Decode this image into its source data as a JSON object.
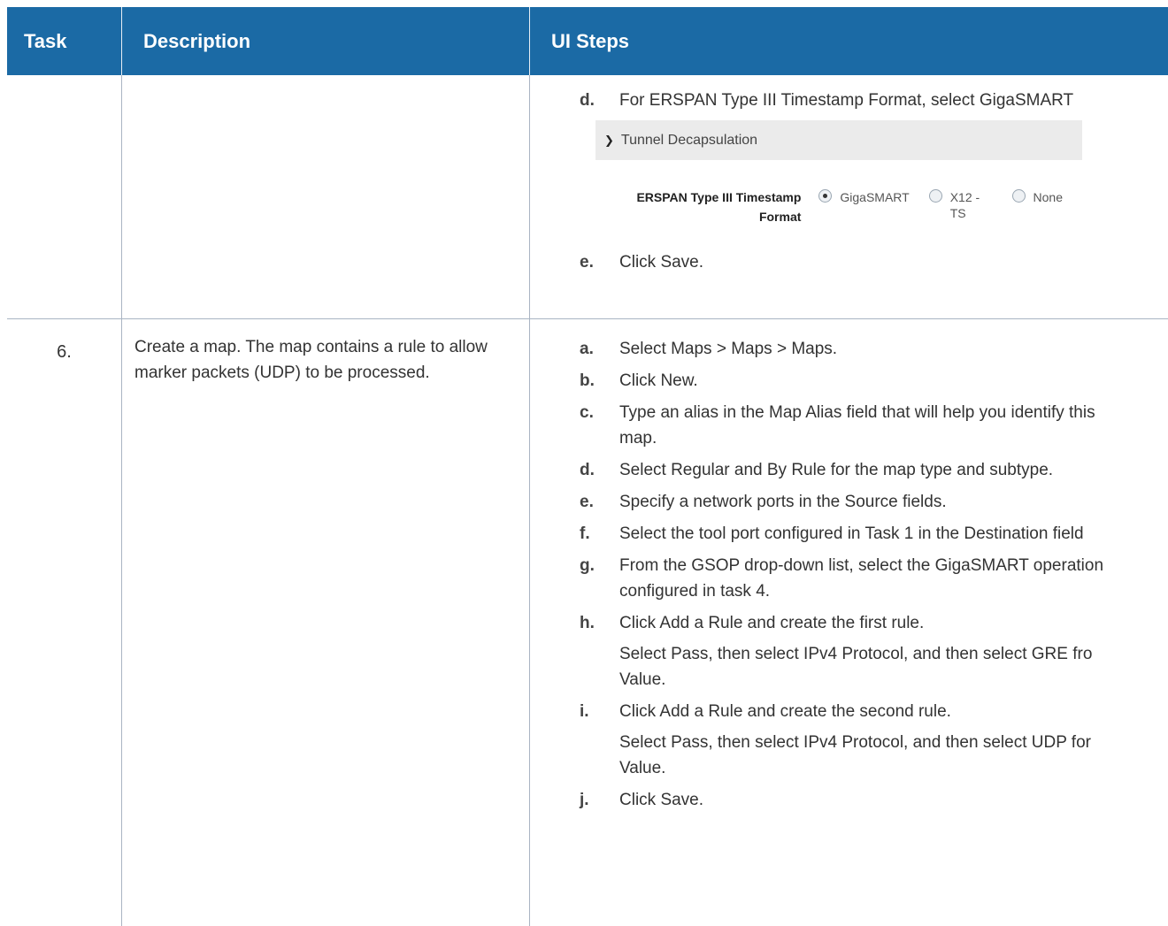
{
  "header": {
    "task": "Task",
    "description": "Description",
    "ui_steps": "UI Steps"
  },
  "row1": {
    "task": "",
    "description": "",
    "steps": [
      {
        "letter": "d.",
        "text": "For ERSPAN Type III Timestamp Format, select GigaSMART"
      },
      {
        "letter": "e.",
        "text": "Click Save."
      }
    ],
    "screenshot": {
      "section_title": "Tunnel Decapsulation",
      "field_label": "ERSPAN Type III Timestamp Format",
      "options": [
        "GigaSMART",
        "X12 - TS",
        "None"
      ],
      "selected": "GigaSMART"
    }
  },
  "row2": {
    "task": "6.",
    "description": "Create a map. The map contains a rule to allow marker packets (UDP) to be processed.",
    "steps": [
      {
        "letter": "a.",
        "text": "Select Maps > Maps > Maps."
      },
      {
        "letter": "b.",
        "text": "Click New."
      },
      {
        "letter": "c.",
        "text": "Type an alias in the Map Alias field that will help you identify this map."
      },
      {
        "letter": "d.",
        "text": "Select Regular and By Rule for the map type and subtype."
      },
      {
        "letter": "e.",
        "text": "Specify a network ports in the Source fields."
      },
      {
        "letter": "f.",
        "text": "Select the tool port configured in Task 1 in the Destination field"
      },
      {
        "letter": "g.",
        "text": "From the GSOP drop-down list, select the GigaSMART operation configured in task 4."
      },
      {
        "letter": "h.",
        "text": "Click Add a Rule and create the first rule.",
        "sub": "Select Pass, then select IPv4 Protocol, and then select GRE fro Value."
      },
      {
        "letter": "i.",
        "text": "Click Add a Rule and create the second rule.",
        "sub": "Select Pass, then select IPv4 Protocol, and then select UDP for Value."
      },
      {
        "letter": "j.",
        "text": "Click Save."
      }
    ]
  }
}
